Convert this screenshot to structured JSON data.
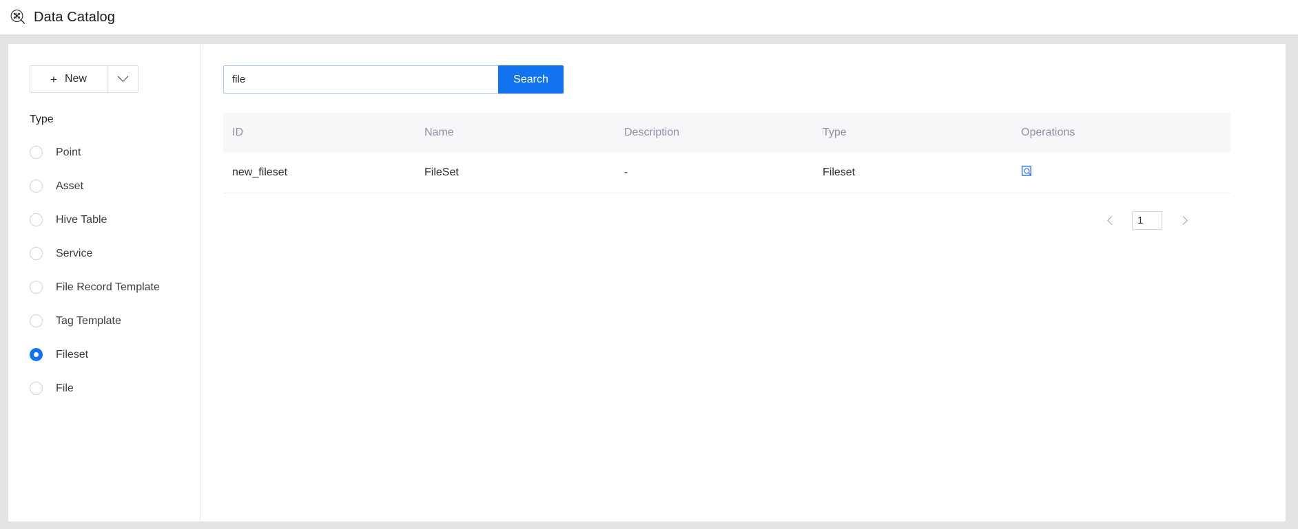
{
  "app": {
    "title": "Data Catalog",
    "logo_icon": "graph-search-icon",
    "accent_color": "#1273f0",
    "header_bg": "#ffffff",
    "page_bg": "#e4e4e4"
  },
  "sidebar": {
    "new_button": {
      "label": "New",
      "plus_icon": "plus-icon",
      "dropdown_icon": "chevron-down-icon"
    },
    "filter": {
      "title": "Type",
      "options": [
        {
          "label": "Point",
          "selected": false
        },
        {
          "label": "Asset",
          "selected": false
        },
        {
          "label": "Hive Table",
          "selected": false
        },
        {
          "label": "Service",
          "selected": false
        },
        {
          "label": "File Record Template",
          "selected": false
        },
        {
          "label": "Tag Template",
          "selected": false
        },
        {
          "label": "Fileset",
          "selected": true
        },
        {
          "label": "File",
          "selected": false
        }
      ]
    }
  },
  "main": {
    "search": {
      "value": "file",
      "placeholder": "",
      "button_label": "Search"
    },
    "table": {
      "columns": [
        "ID",
        "Name",
        "Description",
        "Type",
        "Operations"
      ],
      "rows": [
        {
          "id": "new_fileset",
          "name": "FileSet",
          "description": "-",
          "type": "Fileset",
          "operation_icon": "view-detail-icon"
        }
      ]
    },
    "pagination": {
      "prev_icon": "chevron-left-icon",
      "next_icon": "chevron-right-icon",
      "page": "1"
    }
  }
}
